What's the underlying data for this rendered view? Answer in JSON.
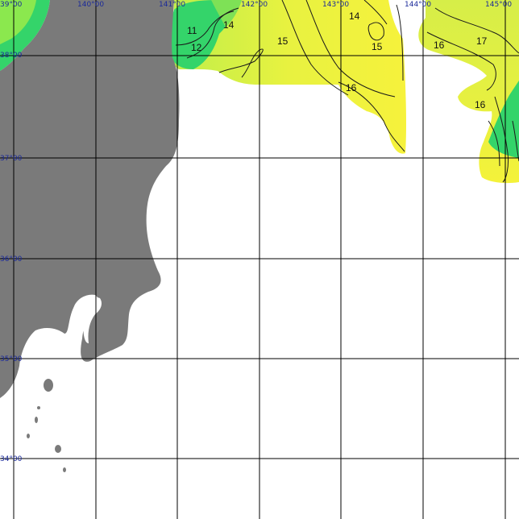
{
  "map": {
    "longitude_labels": [
      "39°00",
      "140°00",
      "141°00",
      "142°00",
      "143°00",
      "144°00",
      "145°00"
    ],
    "latitude_labels": [
      "38°00",
      "37°00",
      "36°00",
      "35°00",
      "34°00"
    ],
    "contour_labels": [
      "11",
      "12",
      "14",
      "14",
      "15",
      "15",
      "16",
      "16",
      "16",
      "17"
    ],
    "colors": {
      "land": "#7a7a7a",
      "water": "#ffffff",
      "sst_warm": "#f6f23c",
      "sst_mid": "#d8f04a",
      "sst_cool": "#34d46a",
      "grid": "#000000",
      "coord_text": "#1b2a9a"
    }
  }
}
